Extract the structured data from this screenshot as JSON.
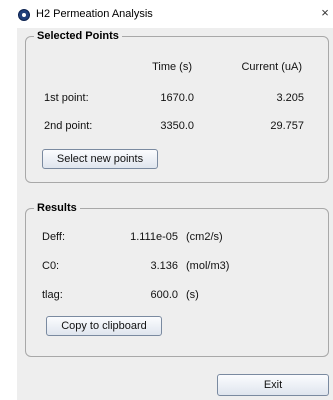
{
  "window": {
    "title": "H2 Permeation Analysis",
    "close_icon": "close-icon"
  },
  "selected_points": {
    "legend": "Selected Points",
    "headers": {
      "time": "Time (s)",
      "current": "Current (uA)"
    },
    "rows": [
      {
        "label": "1st point:",
        "time": "1670.0",
        "current": "3.205"
      },
      {
        "label": "2nd point:",
        "time": "3350.0",
        "current": "29.757"
      }
    ],
    "select_button": "Select new points"
  },
  "results": {
    "legend": "Results",
    "rows": [
      {
        "label": "Deff:",
        "value": "1.111e-05",
        "unit": "(cm2/s)"
      },
      {
        "label": "C0:",
        "value": "3.136",
        "unit": "(mol/m3)"
      },
      {
        "label": "tlag:",
        "value": "600.0",
        "unit": "(s)"
      }
    ],
    "copy_button": "Copy to clipboard"
  },
  "footer": {
    "exit_button": "Exit"
  }
}
